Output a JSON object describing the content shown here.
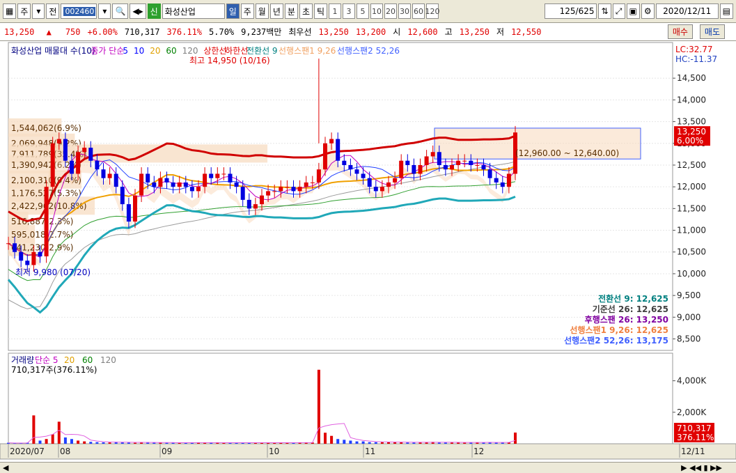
{
  "toolbar": {
    "main_button": "주",
    "prev_label": "전",
    "code": "002460",
    "credit_badge": "신",
    "stock_name": "화성산업",
    "period_tabs": [
      "일",
      "주",
      "월",
      "년",
      "분",
      "초",
      "틱"
    ],
    "selected_period": "일",
    "intervals": [
      "1",
      "3",
      "5",
      "10",
      "20",
      "30",
      "60",
      "120"
    ],
    "count_current": "125",
    "count_total": "/625",
    "date": "2020/12/11"
  },
  "price_bar": {
    "price": "13,250",
    "arrow": "▲",
    "change": "750",
    "change_pct": "+6.00%",
    "volume": "710,317",
    "volume_ratio": "376.11%",
    "turnover": "5.70%",
    "amount": "9,237백만",
    "best_quote_label": "최우선",
    "best_ask": "13,250",
    "best_bid": "13,200",
    "open_label": "시",
    "open": "12,600",
    "high_label": "고",
    "high": "13,250",
    "low_label": "저",
    "low": "12,550",
    "buy_label": "매수",
    "sell_label": "매도"
  },
  "chart_data": {
    "type": "candlestick",
    "title": "화성산업 매물대 수(10)",
    "legend": [
      {
        "text": "화성산업 매물대 수(10)",
        "color": "#000080"
      },
      {
        "text": "종가 단순",
        "color": "#c000c0"
      },
      {
        "text": "5",
        "color": "#0000ff"
      },
      {
        "text": "10",
        "color": "#0000ff"
      },
      {
        "text": "20",
        "color": "#e0a000"
      },
      {
        "text": "60",
        "color": "#008000"
      },
      {
        "text": "120",
        "color": "#808080"
      },
      {
        "text": "상한선",
        "color": "#e00000"
      },
      {
        "text": "하한선",
        "color": "#e00000"
      },
      {
        "text": "전환선 9",
        "color": "#008080"
      },
      {
        "text": "선행스팬1 9,26",
        "color": "#f0a060"
      },
      {
        "text": "선행스팬2 52,26",
        "color": "#4060ff"
      }
    ],
    "lc_hc": [
      "LC:32.77",
      "HC:-11.37"
    ],
    "ylim": [
      8300,
      15000
    ],
    "yticks": [
      14500,
      14000,
      13500,
      13000,
      12500,
      12000,
      11500,
      11000,
      10500,
      10000,
      9500,
      9000,
      8500
    ],
    "ytick_labels": [
      "14,500",
      "14,000",
      "13,500",
      "13,000",
      "12,500",
      "12,000",
      "11,500",
      "11,000",
      "10,500",
      "10,000",
      "9,500",
      "9,000",
      "8,500"
    ],
    "x_labels": [
      "2020/07",
      "08",
      "09",
      "10",
      "11",
      "12",
      "12/11"
    ],
    "high_annotation": "최고 14,950 (10/16)",
    "low_annotation": "최저 9,980 (07/20)",
    "current_price_label": "13,250",
    "current_change_label": "6.00%",
    "volume_profile": [
      {
        "label": "1,544,062(6.9%)",
        "price": 13350,
        "length": 0.08
      },
      {
        "label": "2,069,948(9.2%)",
        "price": 13000,
        "length": 0.1
      },
      {
        "label": "7,911,789(35.4%)",
        "price": 12750,
        "length": 0.39
      },
      {
        "label": "1,390,942(6.2%)",
        "price": 12500,
        "length": 0.07
      },
      {
        "label": "2,100,310(9.4%)",
        "price": 12150,
        "length": 0.11
      },
      {
        "label": "1,176,527(5.3%)",
        "price": 11850,
        "length": 0.07
      },
      {
        "label": "2,422,962(10.8%)",
        "price": 11550,
        "length": 0.13
      },
      {
        "label": "516,887(2.3%)",
        "price": 11200,
        "length": 0.03
      },
      {
        "label": "595,018(2.7%)",
        "price": 10900,
        "length": 0.04
      },
      {
        "label": "641,230(2.9%)",
        "price": 10600,
        "length": 0.04
      }
    ],
    "range_box_label": "(12,960.00 ~ 12,640.00)",
    "ichimoku_values": [
      {
        "text": "전환선 9: 12,625",
        "color": "#008080"
      },
      {
        "text": "기준선 26: 12,625",
        "color": "#404040"
      },
      {
        "text": "후행스팬 26: 13,250",
        "color": "#8000a0"
      },
      {
        "text": "선행스팬1 9,26: 12,625",
        "color": "#f08040"
      },
      {
        "text": "선행스팬2 52,26: 13,175",
        "color": "#4060ff"
      }
    ],
    "volume_panel": {
      "legend": [
        {
          "text": "거래량",
          "color": "#000080"
        },
        {
          "text": "단순 5",
          "color": "#c000c0"
        },
        {
          "text": "20",
          "color": "#e0a000"
        },
        {
          "text": "60",
          "color": "#008000"
        },
        {
          "text": "120",
          "color": "#808080"
        }
      ],
      "value_label": "710,317주(376.11%)",
      "ylim": [
        0,
        5000
      ],
      "yticks": [
        4000,
        2000
      ],
      "ytick_labels": [
        "4,000K",
        "2,000K"
      ],
      "current_value_label": "710,317",
      "current_ratio_label": "376.11%"
    },
    "series": [
      {
        "name": "price",
        "values": [
          10700,
          10500,
          10300,
          10200,
          10500,
          10400,
          12000,
          13000,
          13100,
          12600,
          12300,
          12800,
          12900,
          12600,
          12400,
          12200,
          12300,
          12000,
          11600,
          11200,
          11800,
          12300,
          12100,
          12000,
          12200,
          12100,
          12000,
          12100,
          12000,
          11900,
          12000,
          12300,
          12200,
          12300,
          12300,
          12100,
          12000,
          11700,
          11500,
          11600,
          11800,
          11900,
          11900,
          12000,
          12000,
          11900,
          12000,
          12100,
          12100,
          12400,
          13000,
          13100,
          12600,
          12500,
          12400,
          12300,
          12200,
          12000,
          11900,
          12000,
          12100,
          12200,
          12600,
          12500,
          12300,
          12500,
          12700,
          12800,
          12500,
          12400,
          12500,
          12600,
          12600,
          12500,
          12500,
          12400,
          12200,
          12100,
          12000,
          12300,
          13250
        ]
      },
      {
        "name": "거래량",
        "values": [
          60,
          30,
          40,
          70,
          1800,
          200,
          300,
          600,
          1400,
          400,
          300,
          200,
          150,
          120,
          100,
          90,
          80,
          120,
          100,
          80,
          60,
          80,
          100,
          90,
          70,
          60,
          60,
          50,
          80,
          90,
          70,
          60,
          60,
          80,
          60,
          60,
          60,
          60,
          80,
          60,
          60,
          60,
          70,
          80,
          60,
          60,
          80,
          80,
          80,
          4700,
          700,
          500,
          300,
          250,
          200,
          150,
          150,
          100,
          100,
          100,
          100,
          120,
          100,
          80,
          80,
          100,
          100,
          120,
          80,
          80,
          80,
          80,
          90,
          80,
          80,
          80,
          100,
          80,
          80,
          80,
          710
        ]
      }
    ]
  },
  "status_bar": {
    "left": "◀",
    "right_icons": "▶ ◀◀ ▮ ▶▶"
  }
}
